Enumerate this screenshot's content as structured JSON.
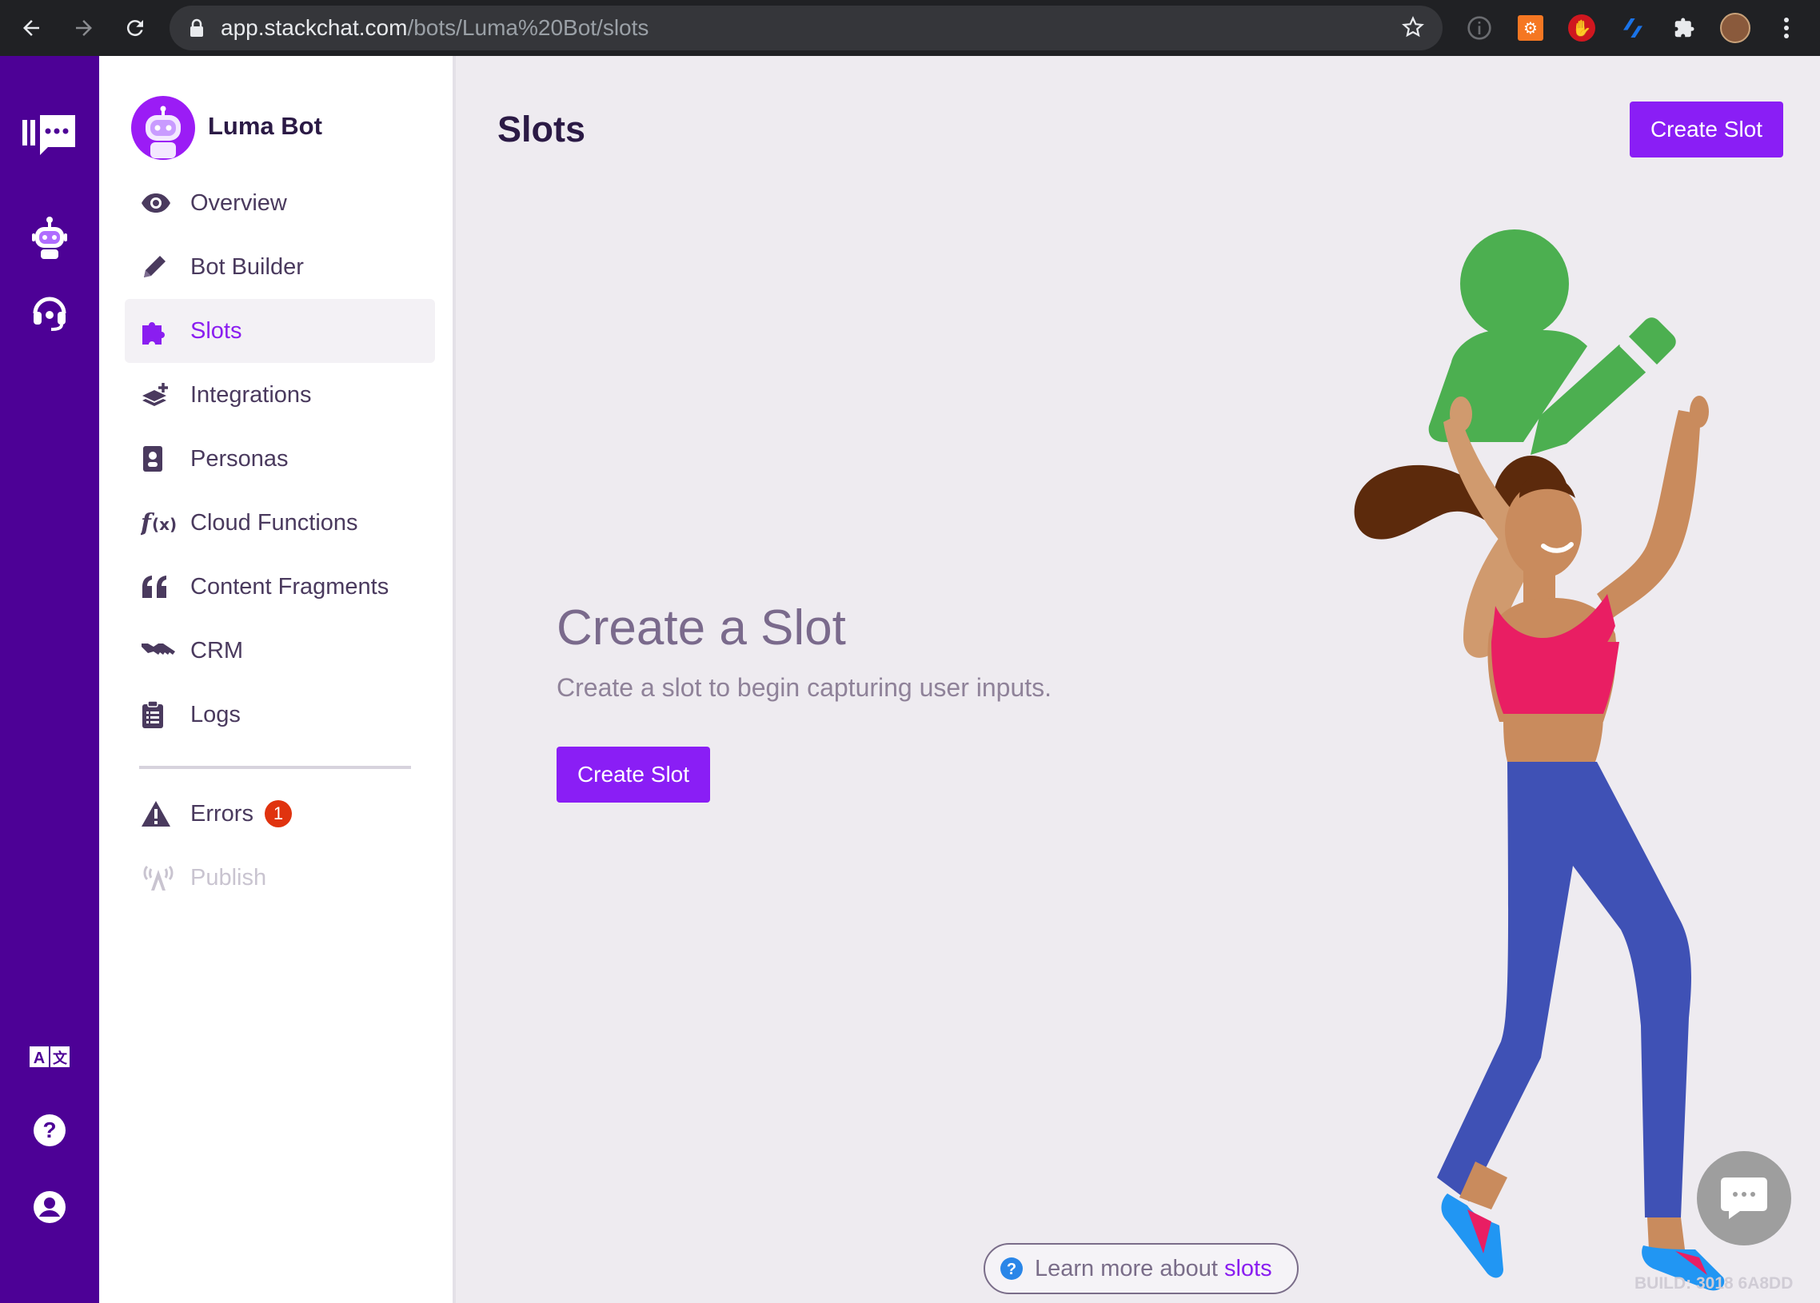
{
  "browser": {
    "url_host": "app.stackchat.com",
    "url_path": "/bots/Luma%20Bot/slots"
  },
  "rail": {
    "items": [
      "stackchat-logo-icon",
      "robot-icon",
      "headset-icon",
      "translate-icon",
      "help-icon",
      "account-icon"
    ]
  },
  "sidebar": {
    "bot_name": "Luma Bot",
    "items": [
      {
        "label": "Overview",
        "icon": "eye-icon"
      },
      {
        "label": "Bot Builder",
        "icon": "pencil-icon"
      },
      {
        "label": "Slots",
        "icon": "puzzle-icon",
        "active": true
      },
      {
        "label": "Integrations",
        "icon": "layers-plus-icon"
      },
      {
        "label": "Personas",
        "icon": "id-badge-icon"
      },
      {
        "label": "Cloud Functions",
        "icon": "function-icon"
      },
      {
        "label": "Content Fragments",
        "icon": "quote-icon"
      },
      {
        "label": "CRM",
        "icon": "handshake-icon"
      },
      {
        "label": "Logs",
        "icon": "clipboard-list-icon"
      }
    ],
    "errors": {
      "label": "Errors",
      "count": "1",
      "icon": "warning-icon"
    },
    "publish": {
      "label": "Publish",
      "icon": "broadcast-icon",
      "disabled": true
    }
  },
  "main": {
    "title": "Slots",
    "create_button": "Create Slot",
    "empty_state": {
      "heading": "Create a Slot",
      "subtext": "Create a slot to begin capturing user inputs.",
      "button": "Create Slot"
    },
    "learn_more": {
      "text": "Learn more about ",
      "link": "slots"
    },
    "build": "BUILD: 3018 6A8DD"
  },
  "colors": {
    "rail": "#4d0196",
    "accent": "#8a1ef5",
    "badge": "#e0330f"
  }
}
